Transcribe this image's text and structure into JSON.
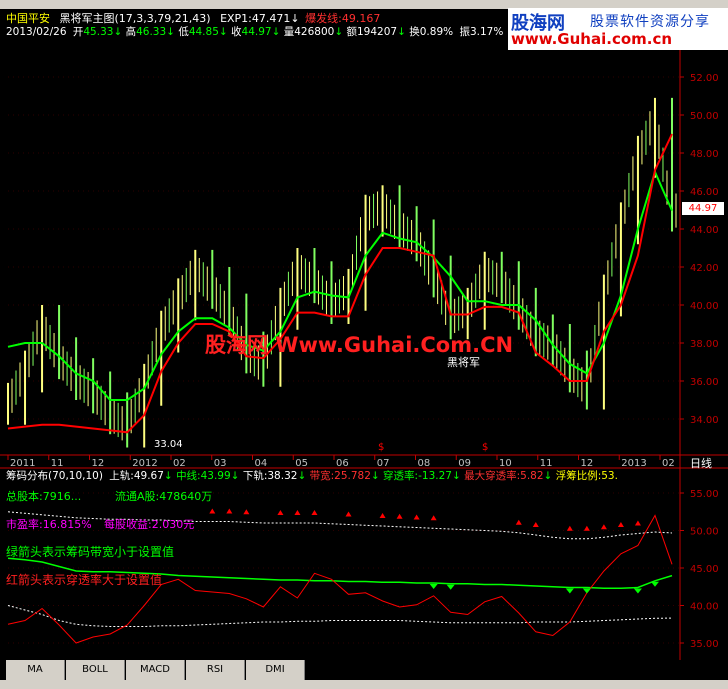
{
  "header": {
    "stock_name": "中国平安",
    "indicator_name": "黑将军主图",
    "indicator_params": "(17,3,3,79,21,43)",
    "exp1_label": "EXP1:",
    "exp1_value": "47.471",
    "exp1_arrow": "↓",
    "burst_label": "爆发线:",
    "burst_value": "49.167",
    "date": "2013/02/26",
    "open_label": "开",
    "open_value": "45.33",
    "high_label": "高",
    "high_value": "46.33",
    "low_label": "低",
    "low_value": "44.85",
    "close_label": "收",
    "close_value": "44.97",
    "vol_label": "量",
    "vol_value": "426800",
    "amt_label": "额",
    "amt_value": "194207",
    "turn_label": "换",
    "turn_value": "0.89%",
    "amp_label": "振",
    "amp_value": "3.17%"
  },
  "logo": {
    "brand": "股海网",
    "slogan": "股票软件资源分享",
    "url": "www.Guhai.com.cn"
  },
  "watermark": {
    "text": "股海网 Www.Guhai.Com.CN",
    "sub": "黑将军"
  },
  "price_label": "44.97",
  "low_annotation": "33.04",
  "date_axis": {
    "labels": [
      "2011",
      "11",
      "12",
      "2012",
      "02",
      "03",
      "04",
      "05",
      "06",
      "07",
      "08",
      "09",
      "10",
      "11",
      "12",
      "2013",
      "02"
    ],
    "period": "日线",
    "markers": [
      "$",
      "$"
    ]
  },
  "chips_header": {
    "name": "筹码分布",
    "params": "(70,10,10)",
    "upper_label": "上轨:",
    "upper_value": "49.67",
    "mid_label": "中线:",
    "mid_value": "43.99",
    "lower_label": "下轨:",
    "lower_value": "38.32",
    "width_label": "带宽:",
    "width_value": "25.782",
    "pen_label": "穿透率:",
    "pen_value": "-13.27",
    "maxpen_label": "最大穿透率:",
    "maxpen_value": "5.82",
    "float_label": "浮筹比例:",
    "float_value": "53."
  },
  "chips_text": {
    "total_shares": "总股本:7916...",
    "float_shares": "流通A股:478640万",
    "pe": "市盈率:16.815%",
    "eps": "每股收益:2.030元",
    "legend_green": "绿箭头表示筹码带宽小于设置值",
    "legend_red": "红箭头表示穿透率大于设置值"
  },
  "tabs": [
    "MA",
    "BOLL",
    "MACD",
    "RSI",
    "DMI"
  ],
  "colors": {
    "background": "#000000",
    "red": "#ff0000",
    "green": "#00ff00",
    "yellow": "#ffff80",
    "axis": "#c00000",
    "white": "#ffffff",
    "cyan": "#00c0ff"
  },
  "chart_data": [
    {
      "type": "line",
      "title": "黑将军主图",
      "y_ticks": [
        34.0,
        36.0,
        38.0,
        40.0,
        42.0,
        44.0,
        46.0,
        48.0,
        50.0,
        52.0
      ],
      "ylim": [
        33.0,
        53.0
      ],
      "x_labels": [
        "2011",
        "11",
        "12",
        "2012",
        "02",
        "03",
        "04",
        "05",
        "06",
        "07",
        "08",
        "09",
        "10",
        "11",
        "12",
        "2013",
        "02"
      ],
      "series": [
        {
          "name": "price_close",
          "values": [
            34.8,
            36.5,
            38.9,
            37.2,
            36.1,
            35.4,
            34.3,
            33.6,
            35.8,
            38.6,
            40.3,
            41.8,
            40.9,
            39.5,
            37.5,
            36.8,
            39.8,
            41.9,
            41.2,
            40.1,
            40.8,
            44.7,
            45.2,
            44.1,
            43.4,
            41.5,
            39.3,
            39.8,
            41.7,
            41.2,
            39.8,
            38.4,
            37.9,
            36.5,
            35.6,
            40.5,
            44.3,
            47.8,
            49.8,
            44.97
          ]
        },
        {
          "name": "red_line",
          "values": [
            33.5,
            33.6,
            33.7,
            33.7,
            33.6,
            33.5,
            33.4,
            33.3,
            34.2,
            36.5,
            38.0,
            39.0,
            39.0,
            38.6,
            37.3,
            37.2,
            38.2,
            39.6,
            39.6,
            39.4,
            39.4,
            41.6,
            43.0,
            43.0,
            42.8,
            42.6,
            39.5,
            39.5,
            39.9,
            39.9,
            39.6,
            37.5,
            36.8,
            36.0,
            36.0,
            38.6,
            40.0,
            42.6,
            47.1,
            49.0
          ]
        },
        {
          "name": "green_line",
          "values": [
            37.8,
            38.0,
            38.0,
            37.3,
            36.4,
            36.0,
            35.0,
            35.0,
            35.6,
            37.4,
            38.6,
            39.3,
            39.3,
            38.8,
            37.9,
            37.6,
            38.6,
            40.4,
            40.7,
            40.5,
            40.4,
            42.6,
            43.8,
            43.5,
            43.3,
            42.5,
            41.5,
            40.2,
            40.2,
            40.0,
            40.0,
            39.2,
            37.9,
            36.9,
            36.4,
            38.0,
            40.5,
            44.0,
            47.0,
            44.97
          ]
        }
      ]
    },
    {
      "type": "line",
      "title": "筹码分布",
      "y_ticks": [
        35.0,
        40.0,
        45.0,
        50.0,
        55.0
      ],
      "ylim": [
        33.0,
        57.0
      ],
      "series": [
        {
          "name": "red_chip",
          "values": [
            37.5,
            38.0,
            39.6,
            37.4,
            35.0,
            35.8,
            36.2,
            37.4,
            40.0,
            42.8,
            43.5,
            42.0,
            41.8,
            41.6,
            40.9,
            39.8,
            42.5,
            41.0,
            44.3,
            43.5,
            41.5,
            41.7,
            40.6,
            39.8,
            40.1,
            41.3,
            39.1,
            38.8,
            40.5,
            41.2,
            39.0,
            36.5,
            36.0,
            37.8,
            41.7,
            44.6,
            46.9,
            48.0,
            52.0,
            45.5
          ]
        },
        {
          "name": "green_chip",
          "values": [
            46.3,
            46.1,
            45.8,
            45.2,
            44.6,
            44.5,
            44.5,
            44.4,
            44.3,
            44.2,
            44.0,
            43.9,
            43.8,
            43.7,
            43.6,
            43.5,
            43.4,
            43.4,
            43.3,
            43.3,
            43.2,
            43.2,
            43.1,
            43.1,
            43.0,
            43.0,
            42.9,
            42.9,
            42.8,
            42.8,
            42.7,
            42.6,
            42.5,
            42.4,
            42.4,
            42.3,
            42.3,
            42.4,
            43.3,
            43.99
          ]
        },
        {
          "name": "white_upper",
          "values": [
            52.5,
            52.3,
            52.1,
            51.9,
            51.7,
            51.6,
            51.5,
            51.5,
            51.4,
            51.4,
            51.3,
            51.2,
            51.2,
            51.2,
            51.1,
            51.0,
            51.0,
            51.0,
            51.0,
            50.9,
            50.8,
            50.7,
            50.6,
            50.5,
            50.4,
            50.3,
            50.2,
            50.1,
            50.0,
            49.9,
            49.7,
            49.4,
            49.1,
            48.9,
            48.9,
            49.1,
            49.4,
            49.6,
            49.8,
            49.67
          ]
        },
        {
          "name": "white_lower",
          "values": [
            40.0,
            39.4,
            38.8,
            38.0,
            37.5,
            37.3,
            37.2,
            37.2,
            37.2,
            37.3,
            37.3,
            37.4,
            37.5,
            37.6,
            37.7,
            37.8,
            37.8,
            37.9,
            37.9,
            38.0,
            38.0,
            38.0,
            38.0,
            38.0,
            37.9,
            37.8,
            37.7,
            37.7,
            37.7,
            37.7,
            37.7,
            37.8,
            37.8,
            37.8,
            37.9,
            38.0,
            38.1,
            38.2,
            38.3,
            38.32
          ]
        }
      ]
    }
  ]
}
